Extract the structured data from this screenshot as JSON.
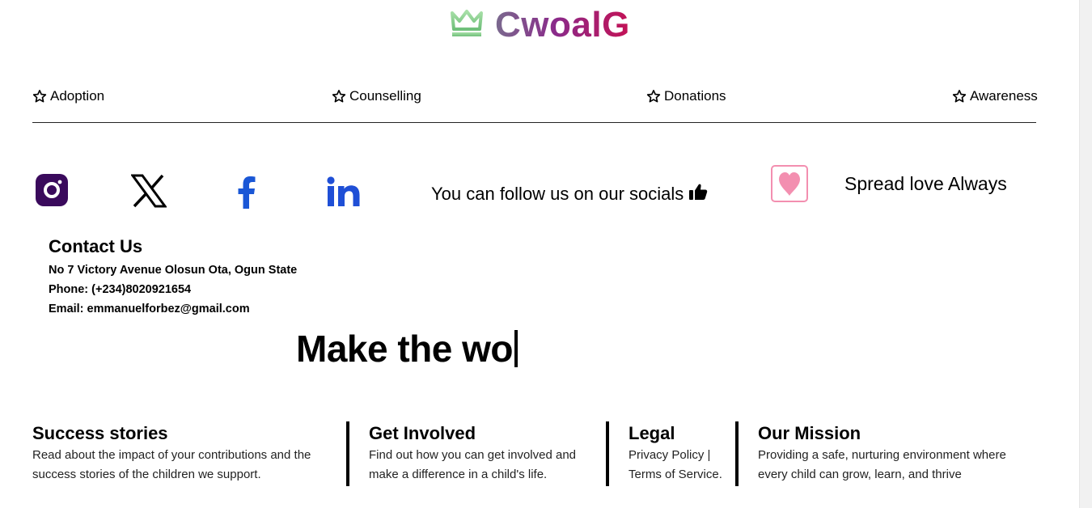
{
  "brand": {
    "name": "CwoalG",
    "logo_icon": "crown-icon"
  },
  "nav": {
    "items": [
      {
        "label": "Adoption",
        "icon": "star-outline-icon"
      },
      {
        "label": "Counselling",
        "icon": "star-outline-icon"
      },
      {
        "label": "Donations",
        "icon": "star-outline-icon"
      },
      {
        "label": "Awareness",
        "icon": "star-outline-icon"
      }
    ]
  },
  "socials": {
    "icons": [
      "instagram-icon",
      "x-twitter-icon",
      "facebook-icon",
      "linkedin-icon"
    ],
    "follow_text": "You can follow us on our socials",
    "follow_icon": "thumbs-up-icon",
    "spread_text": "Spread love Always",
    "spread_icon": "heart-icon"
  },
  "contact": {
    "title": "Contact Us",
    "address": "No 7 Victory Avenue Olosun Ota, Ogun State",
    "phone": "Phone: (+234)8020921654",
    "email": "Email: emmanuelforbez@gmail.com"
  },
  "hero": {
    "typing_text": "Make the wo"
  },
  "footer": {
    "columns": [
      {
        "title": "Success stories",
        "text": "Read about the impact of your contributions and the success stories of the children we support."
      },
      {
        "title": "Get Involved",
        "text": "Find out how you can get involved and make a difference in a child's life."
      },
      {
        "title": "Legal",
        "text": "Privacy Policy | Terms of Service."
      },
      {
        "title": "Our Mission",
        "text": "Providing a safe, nurturing environment where every child can grow, learn, and thrive"
      }
    ]
  },
  "colors": {
    "instagram": "#3a0a5c",
    "x": "#000000",
    "facebook": "#1a57d6",
    "linkedin": "#1f4fd6",
    "heart": "#f38fb0",
    "logo_crown": "#7fcf8a"
  }
}
